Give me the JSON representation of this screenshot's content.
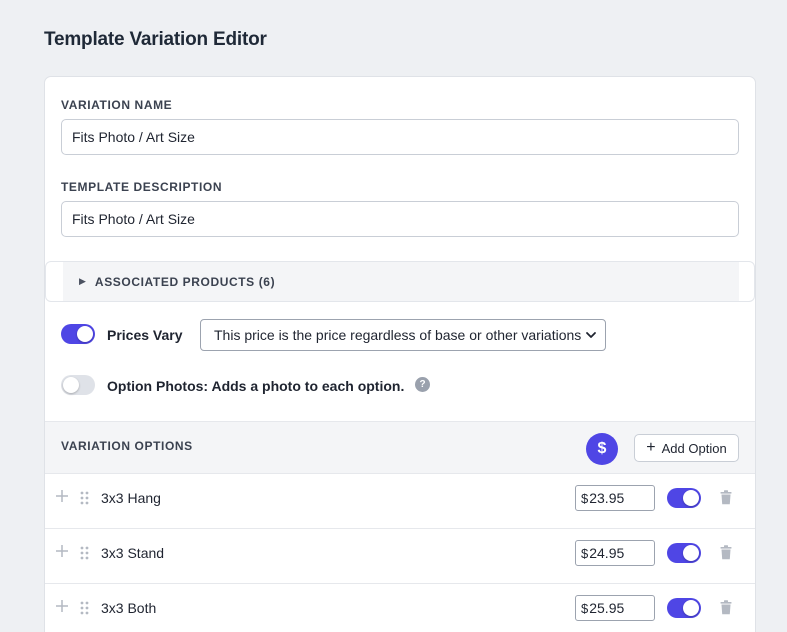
{
  "page": {
    "title": "Template Variation Editor"
  },
  "form": {
    "variation_name_label": "VARIATION NAME",
    "variation_name_value": "Fits Photo / Art Size",
    "description_label": "TEMPLATE DESCRIPTION",
    "description_value": "Fits Photo / Art Size"
  },
  "associated_products": {
    "label": "ASSOCIATED PRODUCTS (6)",
    "expanded": false
  },
  "prices_vary": {
    "label": "Prices Vary",
    "enabled": true,
    "selected_option": "This price is the price regardless of base or other variations"
  },
  "option_photos": {
    "label": "Option Photos: Adds a photo to each option.",
    "enabled": false,
    "help_glyph": "?"
  },
  "variation_options": {
    "title": "VARIATION OPTIONS",
    "currency_button_glyph": "$",
    "add_button_label": "Add Option",
    "rows": [
      {
        "name": "3x3 Hang",
        "currency": "$",
        "price": "23.95",
        "enabled": true
      },
      {
        "name": "3x3 Stand",
        "currency": "$",
        "price": "24.95",
        "enabled": true
      },
      {
        "name": "3x3 Both",
        "currency": "$",
        "price": "25.95",
        "enabled": true
      }
    ]
  },
  "colors": {
    "accent": "#4f46e5",
    "toggle_off": "#dfe2e8",
    "muted_icon": "#b4b9c2"
  },
  "icons": [
    "caret-right-icon",
    "chevron-down-icon",
    "help-icon",
    "dollar-icon",
    "plus-icon",
    "drag-handle-icon",
    "trash-icon"
  ]
}
